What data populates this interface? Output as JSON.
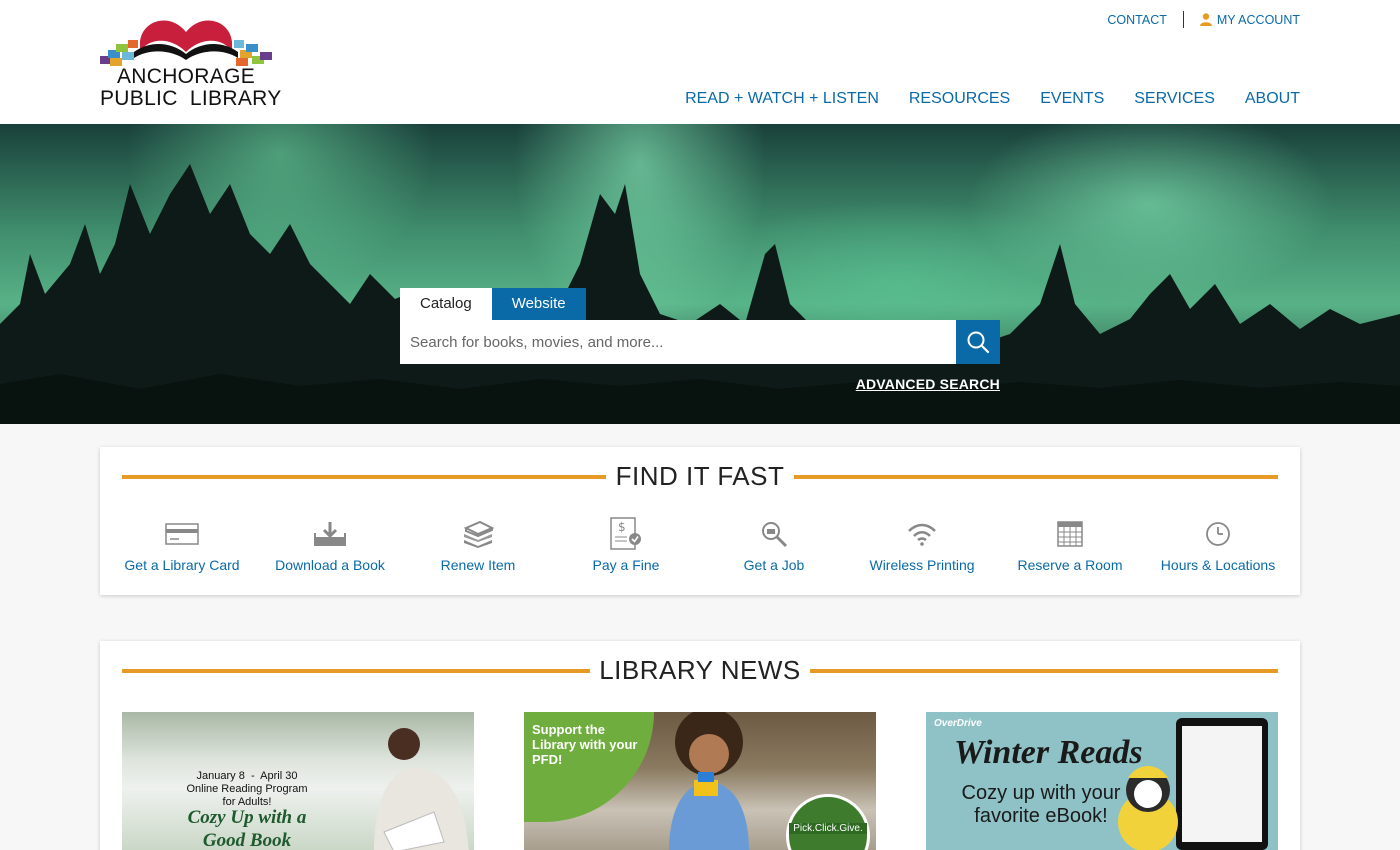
{
  "brand": {
    "name_line1": "ANCHORAGE",
    "name_line2": "PUBLIC  LIBRARY"
  },
  "top_links": {
    "contact": "CONTACT",
    "account": "MY ACCOUNT"
  },
  "nav": {
    "items": [
      {
        "label": "READ + WATCH + LISTEN"
      },
      {
        "label": "RESOURCES"
      },
      {
        "label": "EVENTS"
      },
      {
        "label": "SERVICES"
      },
      {
        "label": "ABOUT"
      }
    ]
  },
  "search": {
    "tabs": [
      {
        "label": "Catalog",
        "active": true
      },
      {
        "label": "Website",
        "active": false
      }
    ],
    "placeholder": "Search for books, movies, and more...",
    "advanced": "ADVANCED SEARCH"
  },
  "find_it_fast": {
    "title": "FIND IT FAST",
    "items": [
      {
        "label": "Get a Library Card",
        "icon": "library-card-icon"
      },
      {
        "label": "Download a Book",
        "icon": "download-icon"
      },
      {
        "label": "Renew Item",
        "icon": "books-stack-icon"
      },
      {
        "label": "Pay a Fine",
        "icon": "bill-icon"
      },
      {
        "label": "Get a Job",
        "icon": "magnifier-icon"
      },
      {
        "label": "Wireless Printing",
        "icon": "wifi-icon"
      },
      {
        "label": "Reserve a Room",
        "icon": "calendar-icon"
      },
      {
        "label": "Hours & Locations",
        "icon": "clock-icon"
      }
    ]
  },
  "library_news": {
    "title": "LIBRARY NEWS",
    "cards": [
      {
        "date_line": "January 8  -  April 30",
        "line2": "Online Reading Program",
        "line3": "for Adults!",
        "headline_1": "Cozy Up with a",
        "headline_2": "Good Book"
      },
      {
        "headline": "Support the Library with your PFD!",
        "badge": "Pick.Click.Give."
      },
      {
        "brand": "OverDrive",
        "headline": "Winter Reads",
        "subline_1": "Cozy up with your",
        "subline_2": "favorite eBook!"
      }
    ]
  },
  "colors": {
    "primary_blue": "#0a6aa8",
    "accent_orange": "#e89a26"
  }
}
